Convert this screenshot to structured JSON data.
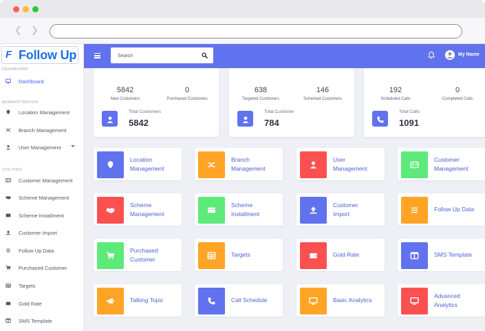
{
  "brand": {
    "logo_mark": "F",
    "logo_text": "Follow Up"
  },
  "search": {
    "placeholder": "Search"
  },
  "user": {
    "name": "My Name"
  },
  "colors": {
    "header": "#6172ee",
    "blue": "#6172ee",
    "orange": "#ffa425",
    "red": "#fb5050",
    "green": "#5dea7b",
    "link": "#4c5fd6"
  },
  "sidebar": {
    "sections": {
      "dashboard": "DASHBOARD",
      "administration": "ADMINISTRATION",
      "utilities": "UTILITIES"
    },
    "items": [
      {
        "label": "Dashboard",
        "icon": "monitor-icon"
      },
      {
        "label": "Location Management",
        "icon": "map-pin-icon"
      },
      {
        "label": "Branch Management",
        "icon": "shuffle-icon"
      },
      {
        "label": "User Management",
        "icon": "user-icon"
      },
      {
        "label": "Customer Management",
        "icon": "id-card-icon"
      },
      {
        "label": "Scheme Management",
        "icon": "handshake-icon"
      },
      {
        "label": "Scheme Installment",
        "icon": "credit-card-icon"
      },
      {
        "label": "Customer Import",
        "icon": "upload-icon"
      },
      {
        "label": "Follow Up Data",
        "icon": "list-icon"
      },
      {
        "label": "Purchased Customer",
        "icon": "cart-icon"
      },
      {
        "label": "Targets",
        "icon": "table-icon"
      },
      {
        "label": "Gold Rate",
        "icon": "wallet-icon"
      },
      {
        "label": "SMS Template",
        "icon": "template-icon"
      }
    ]
  },
  "stats": [
    {
      "a_value": "5842",
      "a_label": "New Customers",
      "b_value": "0",
      "b_label": "Purchased Customers",
      "total_label": "Total Customers",
      "total_value": "5842",
      "icon": "user-icon"
    },
    {
      "a_value": "638",
      "a_label": "Targeted Customers",
      "b_value": "146",
      "b_label": "Schemed Customers",
      "total_label": "Total Customer",
      "total_value": "784",
      "icon": "user-icon"
    },
    {
      "a_value": "192",
      "a_label": "Scheduled Calls",
      "b_value": "0",
      "b_label": "Completed Calls",
      "total_label": "Total Calls",
      "total_value": "1091",
      "icon": "phone-icon"
    }
  ],
  "tiles": [
    {
      "line1": "Location",
      "line2": "Management",
      "color": "#6172ee",
      "icon": "map-pin-icon"
    },
    {
      "line1": "Branch",
      "line2": "Management",
      "color": "#ffa425",
      "icon": "shuffle-icon"
    },
    {
      "line1": "User",
      "line2": "Management",
      "color": "#fb5050",
      "icon": "user-icon"
    },
    {
      "line1": "Customer",
      "line2": "Management",
      "color": "#5dea7b",
      "icon": "id-card-icon"
    },
    {
      "line1": "Scheme",
      "line2": "Management",
      "color": "#fb5050",
      "icon": "handshake-icon"
    },
    {
      "line1": "Scheme",
      "line2": "Installment",
      "color": "#5dea7b",
      "icon": "credit-card-icon"
    },
    {
      "line1": "Customer",
      "line2": "Import",
      "color": "#6172ee",
      "icon": "upload-icon"
    },
    {
      "line1": "Follow Up Data",
      "line2": "",
      "color": "#ffa425",
      "icon": "list-icon"
    },
    {
      "line1": "Purchased",
      "line2": "Customer",
      "color": "#5dea7b",
      "icon": "cart-icon"
    },
    {
      "line1": "Targets",
      "line2": "",
      "color": "#ffa425",
      "icon": "table-icon"
    },
    {
      "line1": "Gold Rate",
      "line2": "",
      "color": "#fb5050",
      "icon": "wallet-icon"
    },
    {
      "line1": "SMS Template",
      "line2": "",
      "color": "#6172ee",
      "icon": "template-icon"
    },
    {
      "line1": "Talking Topic",
      "line2": "",
      "color": "#ffa425",
      "icon": "megaphone-icon"
    },
    {
      "line1": "Call Schedule",
      "line2": "",
      "color": "#6172ee",
      "icon": "phone-icon"
    },
    {
      "line1": "Basic Analytics",
      "line2": "",
      "color": "#ffa425",
      "icon": "monitor-icon"
    },
    {
      "line1": "Advanced",
      "line2": "Analytics",
      "color": "#fb5050",
      "icon": "monitor-icon"
    }
  ]
}
